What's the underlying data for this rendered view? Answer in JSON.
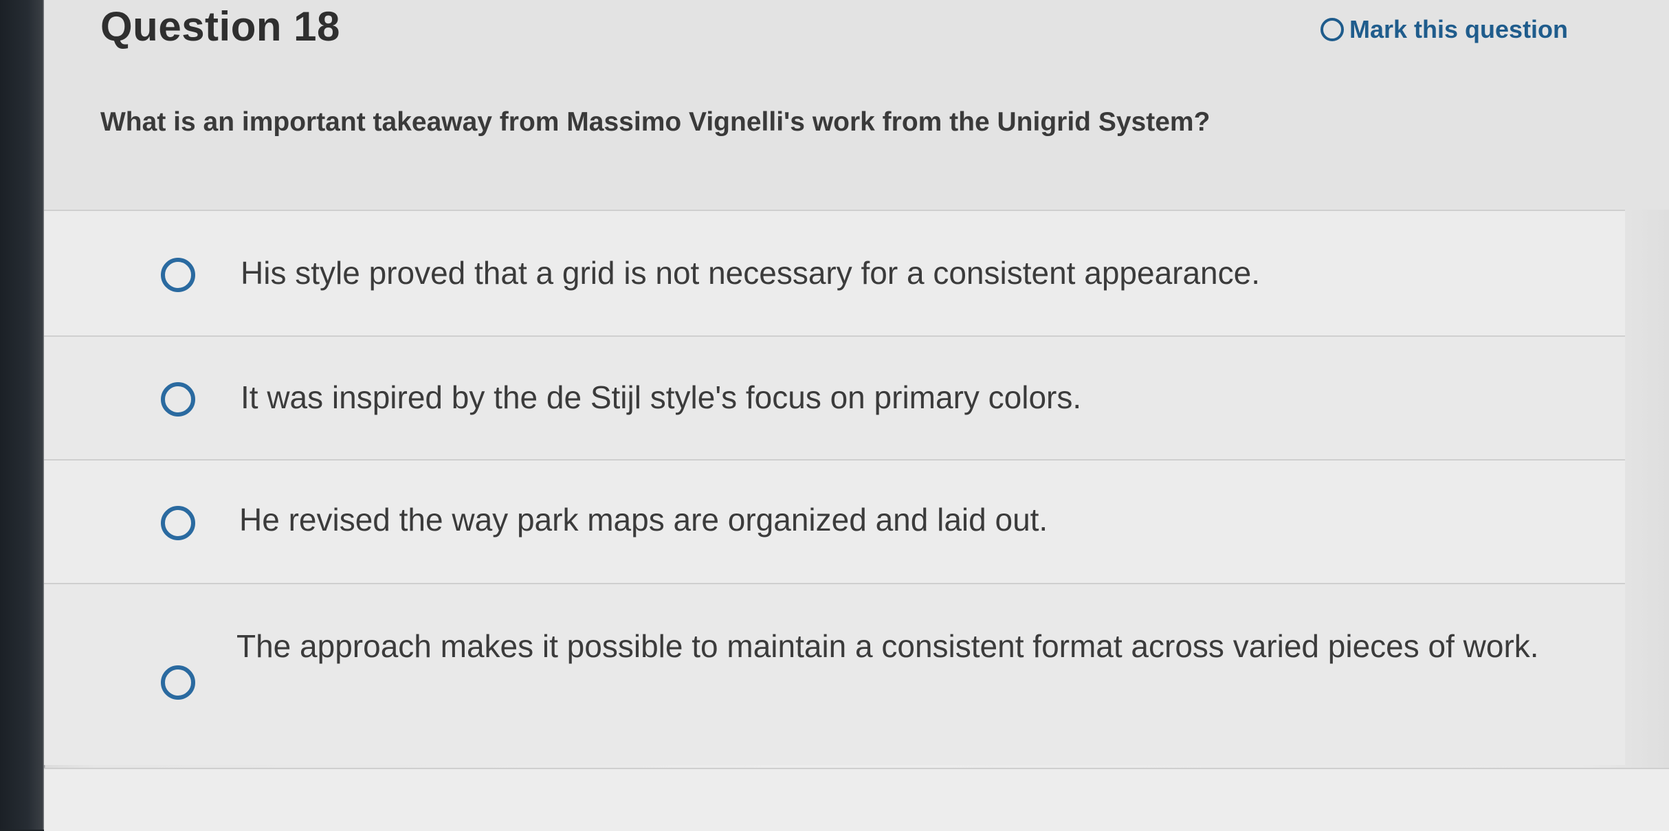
{
  "question": {
    "title": "Question 18",
    "mark_label": "Mark this question",
    "text": "What is an important takeaway from Massimo Vignelli's work from the Unigrid System?"
  },
  "options": [
    {
      "label": "His style proved that a grid is not necessary for a consistent appearance."
    },
    {
      "label": "It was inspired by the de Stijl style's focus on primary colors."
    },
    {
      "label": "He revised the way park maps are organized and laid out."
    },
    {
      "label": "The approach makes it possible to maintain a consistent format across varied pieces of work."
    }
  ],
  "colors": {
    "accent": "#1f5c8c",
    "radio": "#2a6aa0",
    "text": "#3b3b3b",
    "background": "#ebebeb"
  },
  "icons": {
    "mark": "circle-outline-icon",
    "radio": "radio-unchecked-icon"
  }
}
